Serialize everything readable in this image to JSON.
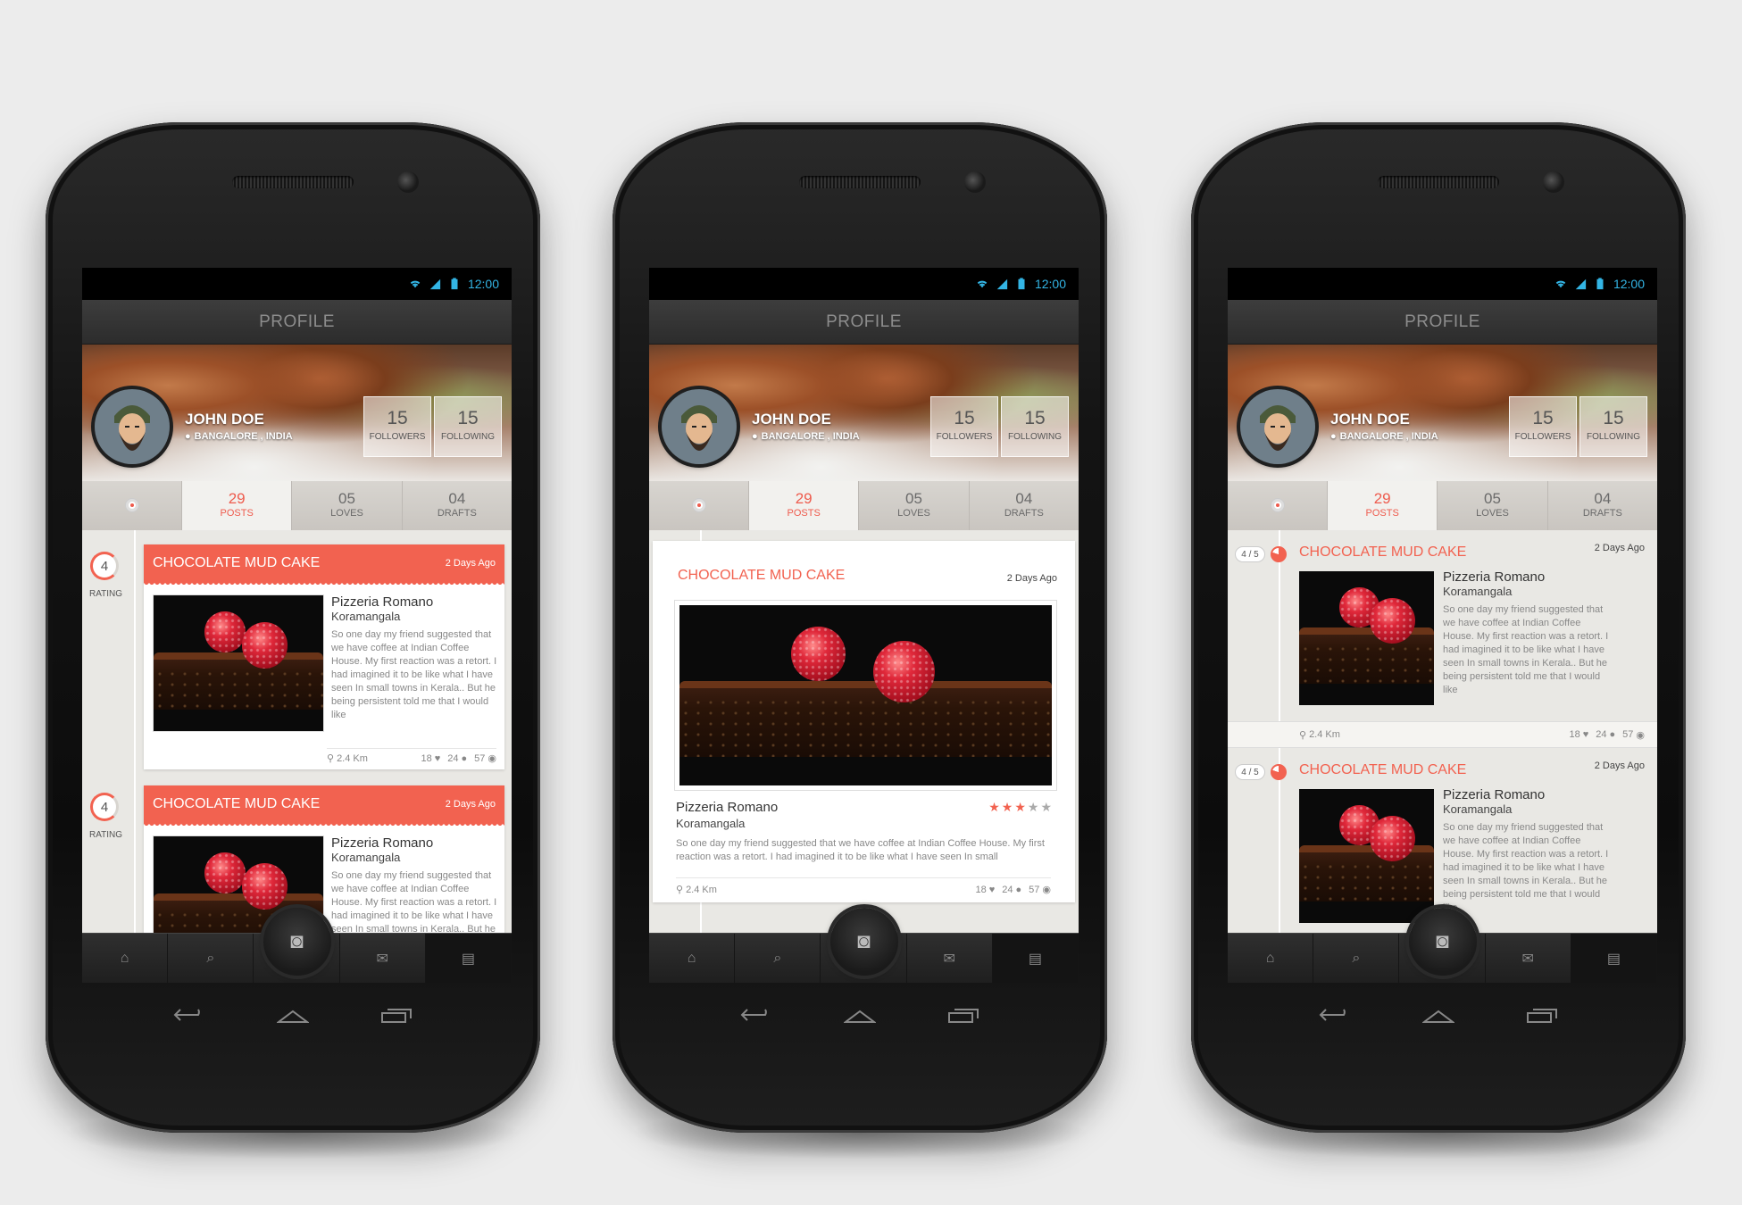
{
  "status": {
    "time": "12:00"
  },
  "profile": {
    "title": "PROFILE",
    "name": "JOHN DOE",
    "location": "BANGALORE , INDIA",
    "followers": {
      "count": "15",
      "label": "FOLLOWERS"
    },
    "following": {
      "count": "15",
      "label": "FOLLOWING"
    }
  },
  "tabs": [
    {
      "count": "29",
      "label": "POSTS"
    },
    {
      "count": "05",
      "label": "LOVES"
    },
    {
      "count": "04",
      "label": "DRAFTS"
    }
  ],
  "post": {
    "title": "CHOCOLATE MUD CAKE",
    "date": "2 Days Ago",
    "place": "Pizzeria Romano",
    "area": "Koramangala",
    "desc_short": "So one day my friend suggested that we have coffee at Indian Coffee House. My first reaction was a retort. I had imagined it to be like what I have seen In small towns in Kerala.. But he being persistent told me that I would like",
    "desc_long": "So one day my friend suggested that we have coffee at Indian Coffee House. My first reaction was a retort. I had imagined it to be like what I have seen In small",
    "distance": "2.4 Km",
    "loves": "18",
    "comments": "24",
    "views": "57",
    "rating": "4",
    "rating_label": "RATING",
    "rating_fraction": "4 / 5",
    "stars": 3
  },
  "icons": [
    "wifi-icon",
    "signal-icon",
    "battery-icon",
    "home-icon",
    "search-icon",
    "camera-icon",
    "chat-icon",
    "feed-icon",
    "back-icon",
    "home-key-icon",
    "recent-icon",
    "location-pin-icon",
    "heart-icon",
    "comment-icon",
    "eye-icon"
  ]
}
